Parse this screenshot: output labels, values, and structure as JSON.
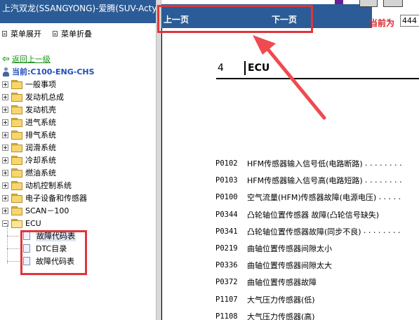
{
  "left_panel": {
    "title": "上汽双龙(SSANGYONG)-爱腾(SUV-Actyon",
    "menu": {
      "expand_all": "菜单展开",
      "collapse_all": "菜单折叠"
    },
    "back_link": "返回上一级",
    "current": "当前:C100-ENG-CHS",
    "tree": [
      {
        "label": "一般事项",
        "state": "collapsed"
      },
      {
        "label": "发动机总成",
        "state": "collapsed"
      },
      {
        "label": "发动机壳",
        "state": "collapsed"
      },
      {
        "label": "进气系统",
        "state": "collapsed"
      },
      {
        "label": "排气系统",
        "state": "collapsed"
      },
      {
        "label": "润滑系统",
        "state": "collapsed"
      },
      {
        "label": "冷却系统",
        "state": "collapsed"
      },
      {
        "label": "燃油系统",
        "state": "collapsed"
      },
      {
        "label": "动机控制系统",
        "state": "collapsed"
      },
      {
        "label": "电子设备和传感器",
        "state": "collapsed"
      },
      {
        "label": "SCAN－100",
        "state": "collapsed"
      },
      {
        "label": "ECU",
        "state": "expanded"
      }
    ],
    "ecu_children": [
      {
        "label": "故障代码表",
        "selected": true
      },
      {
        "label": "DTC目录",
        "selected": false
      },
      {
        "label": "故障代码表",
        "selected": false
      }
    ]
  },
  "nav": {
    "prev_label": "上一页",
    "next_label": "下一页",
    "current_label": "当前为",
    "page_value": "444"
  },
  "document": {
    "section_number": "4",
    "section_name": "ECU",
    "codes": [
      {
        "code": "P0102",
        "desc": "HFM传感器输入信号低(电路断路)",
        "dots": "........"
      },
      {
        "code": "P0103",
        "desc": "HFM传感器输入信号高(电路短路)",
        "dots": "........"
      },
      {
        "code": "P0100",
        "desc": "空气流量(HFM)传感器故障(电源电压)",
        "dots": "....."
      },
      {
        "code": "P0344",
        "desc": "凸轮轴位置传感器 故障(凸轮信号缺失)",
        "dots": ""
      },
      {
        "code": "P0341",
        "desc": "凸轮轴位置传感器故障(同步不良)",
        "dots": "........"
      },
      {
        "code": "P0219",
        "desc": "曲轴位置传感器间隙太小",
        "dots": ""
      },
      {
        "code": "P0336",
        "desc": "曲轴位置传感器间隙太大",
        "dots": ""
      },
      {
        "code": "P0372",
        "desc": "曲轴位置传感器故障",
        "dots": ""
      },
      {
        "code": "P1107",
        "desc": "大气压力传感器(低)",
        "dots": ""
      },
      {
        "code": "P1108",
        "desc": "大气压力传感器(高)",
        "dots": ""
      }
    ]
  },
  "colors": {
    "title_bar": "#2b5c97",
    "highlight": "#e0353b",
    "current_label": "#d8262b",
    "back_link": "#1a8f1a"
  }
}
